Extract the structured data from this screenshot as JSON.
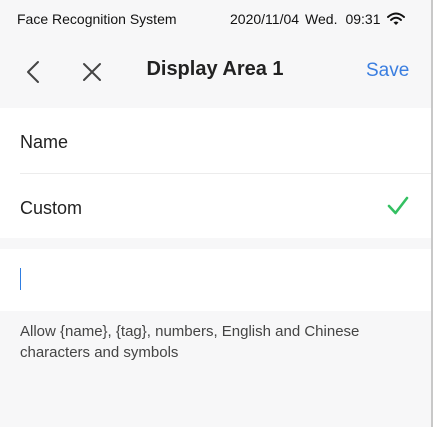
{
  "status_bar": {
    "app_name": "Face Recognition System",
    "date": "2020/11/04",
    "day": "Wed.",
    "time": "09:31"
  },
  "header": {
    "title": "Display Area 1",
    "save_label": "Save"
  },
  "options": [
    {
      "label": "Name",
      "selected": false
    },
    {
      "label": "Custom",
      "selected": true
    }
  ],
  "custom_input": {
    "value": "",
    "placeholder": ""
  },
  "hint": "Allow {name}, {tag}, numbers, English and Chinese characters and symbols",
  "colors": {
    "accent": "#3a7ee0",
    "check": "#34c062",
    "background": "#f7f7f8"
  },
  "icons": [
    "wifi-icon",
    "back-icon",
    "close-icon",
    "checkmark-icon"
  ]
}
